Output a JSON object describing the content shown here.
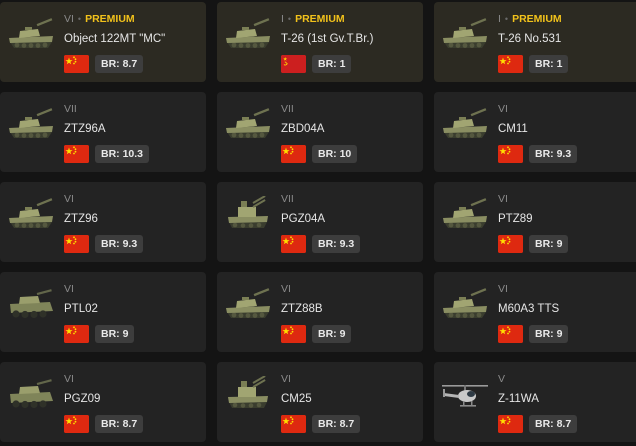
{
  "vehicles": [
    {
      "tier": "VI",
      "premium": true,
      "premium_label": "PREMIUM",
      "name": "Object 122MT \"MC\"",
      "flag": "china",
      "flag_icon": "china-flag-icon",
      "br": "BR: 8.7",
      "kind": "tank"
    },
    {
      "tier": "I",
      "premium": true,
      "premium_label": "PREMIUM",
      "name": "T-26 (1st Gv.T.Br.)",
      "flag": "ussr",
      "flag_icon": "ussr-flag-icon",
      "br": "BR: 1",
      "kind": "tank"
    },
    {
      "tier": "I",
      "premium": true,
      "premium_label": "PREMIUM",
      "name": "T-26 No.531",
      "flag": "china",
      "flag_icon": "china-flag-icon",
      "br": "BR: 1",
      "kind": "tank"
    },
    {
      "tier": "VII",
      "premium": false,
      "premium_label": "",
      "name": "ZTZ96A",
      "flag": "china",
      "flag_icon": "china-flag-icon",
      "br": "BR: 10.3",
      "kind": "tank"
    },
    {
      "tier": "VII",
      "premium": false,
      "premium_label": "",
      "name": "ZBD04A",
      "flag": "china",
      "flag_icon": "china-flag-icon",
      "br": "BR: 10",
      "kind": "tank"
    },
    {
      "tier": "VI",
      "premium": false,
      "premium_label": "",
      "name": "CM11",
      "flag": "china",
      "flag_icon": "china-flag-icon",
      "br": "BR: 9.3",
      "kind": "tank"
    },
    {
      "tier": "VI",
      "premium": false,
      "premium_label": "",
      "name": "ZTZ96",
      "flag": "china",
      "flag_icon": "china-flag-icon",
      "br": "BR: 9.3",
      "kind": "tank"
    },
    {
      "tier": "VII",
      "premium": false,
      "premium_label": "",
      "name": "PGZ04A",
      "flag": "china",
      "flag_icon": "china-flag-icon",
      "br": "BR: 9.3",
      "kind": "spaa"
    },
    {
      "tier": "VI",
      "premium": false,
      "premium_label": "",
      "name": "PTZ89",
      "flag": "china",
      "flag_icon": "china-flag-icon",
      "br": "BR: 9",
      "kind": "tank"
    },
    {
      "tier": "VI",
      "premium": false,
      "premium_label": "",
      "name": "PTL02",
      "flag": "china",
      "flag_icon": "china-flag-icon",
      "br": "BR: 9",
      "kind": "wheeled"
    },
    {
      "tier": "VI",
      "premium": false,
      "premium_label": "",
      "name": "ZTZ88B",
      "flag": "china",
      "flag_icon": "china-flag-icon",
      "br": "BR: 9",
      "kind": "tank"
    },
    {
      "tier": "VI",
      "premium": false,
      "premium_label": "",
      "name": "M60A3 TTS",
      "flag": "china",
      "flag_icon": "china-flag-icon",
      "br": "BR: 9",
      "kind": "tank"
    },
    {
      "tier": "VI",
      "premium": false,
      "premium_label": "",
      "name": "PGZ09",
      "flag": "china",
      "flag_icon": "china-flag-icon",
      "br": "BR: 8.7",
      "kind": "wheeled"
    },
    {
      "tier": "VI",
      "premium": false,
      "premium_label": "",
      "name": "CM25",
      "flag": "china",
      "flag_icon": "china-flag-icon",
      "br": "BR: 8.7",
      "kind": "spaa"
    },
    {
      "tier": "V",
      "premium": false,
      "premium_label": "",
      "name": "Z-11WA",
      "flag": "china",
      "flag_icon": "china-flag-icon",
      "br": "BR: 8.7",
      "kind": "helicopter"
    }
  ],
  "colors": {
    "page_bg": "#141414",
    "card_bg": "#232323",
    "premium_card_bg": "#2c2a22",
    "premium_text": "#f2c21b",
    "tier_text": "#8a8a8a",
    "name_text": "#e6e6e6",
    "br_badge_bg": "#3d3d3d",
    "china_flag": "#de2910",
    "ussr_flag": "#cc1f1f"
  }
}
